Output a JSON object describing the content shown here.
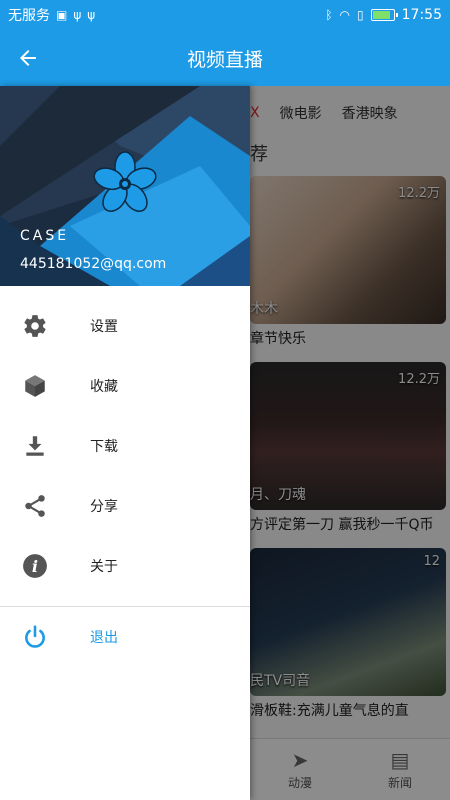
{
  "status_bar": {
    "carrier": "无服务",
    "time": "17:55",
    "battery_level": 0.8
  },
  "app_bar": {
    "title": "视频直播"
  },
  "background": {
    "tabs": [
      "X",
      "微电影",
      "香港映象"
    ],
    "section_title": "荐",
    "cards": [
      {
        "count": "12.2万",
        "overlay_name": "木木",
        "caption": "章节快乐"
      },
      {
        "count": "12.2万",
        "overlay_name": "月、刀魂",
        "caption": "方评定第一刀 赢我秒一千Q币"
      },
      {
        "count": "12",
        "overlay_name": "民TV司音",
        "caption": "滑板鞋:充满儿童气息的直"
      }
    ],
    "bottom_nav": [
      {
        "label": "动漫",
        "icon": "paper-plane-icon"
      },
      {
        "label": "新闻",
        "icon": "newspaper-icon"
      }
    ]
  },
  "drawer": {
    "user_name": "CASE",
    "user_email": "445181052@qq.com",
    "menu_items": [
      {
        "label": "设置",
        "icon": "gear-icon"
      },
      {
        "label": "收藏",
        "icon": "cube-icon"
      },
      {
        "label": "下载",
        "icon": "download-icon"
      },
      {
        "label": "分享",
        "icon": "share-icon"
      },
      {
        "label": "关于",
        "icon": "info-icon"
      }
    ],
    "logout": {
      "label": "退出",
      "icon": "power-icon"
    }
  },
  "colors": {
    "primary": "#1e9be6",
    "logout_accent": "#1e9be6",
    "flower": "#1e9be6"
  }
}
